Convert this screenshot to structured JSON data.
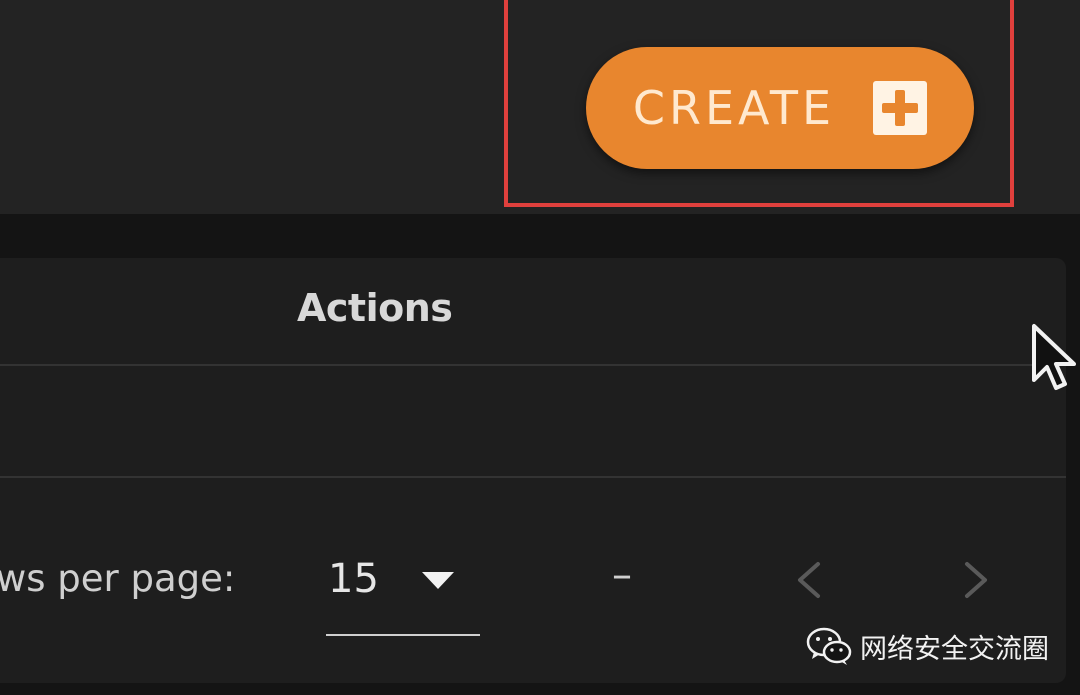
{
  "header": {
    "create_button_label": "CREATE"
  },
  "table": {
    "columns": [
      "Actions"
    ]
  },
  "pagination": {
    "rows_per_page_label": "ws per page:",
    "page_size": "15",
    "range_text": "–"
  },
  "watermark": {
    "text": "网络安全交流圈",
    "icon": "wechat-icon"
  },
  "colors": {
    "accent": "#e8862e",
    "highlight": "#e0403d",
    "background": "#232323"
  }
}
